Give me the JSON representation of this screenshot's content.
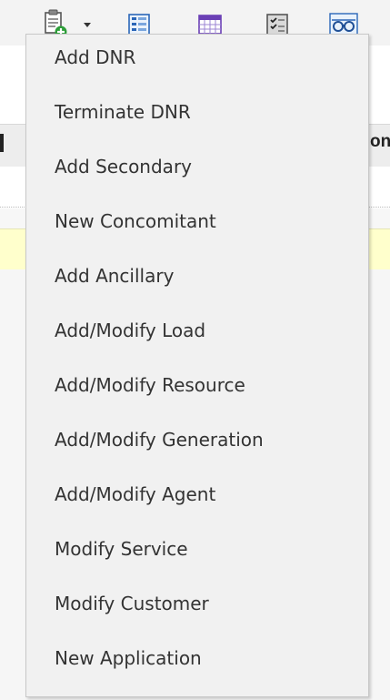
{
  "toolbar": {
    "icons": [
      "clipboard-add-icon",
      "chevron-down-icon",
      "list-view-icon",
      "grid-view-icon",
      "checklist-icon",
      "glasses-icon"
    ]
  },
  "menu": {
    "items": [
      {
        "label": "Add DNR"
      },
      {
        "label": "Terminate DNR"
      },
      {
        "label": "Add Secondary"
      },
      {
        "label": "New Concomitant"
      },
      {
        "label": "Add Ancillary"
      },
      {
        "label": "Add/Modify Load"
      },
      {
        "label": "Add/Modify Resource"
      },
      {
        "label": "Add/Modify Generation"
      },
      {
        "label": "Add/Modify Agent"
      },
      {
        "label": "Modify Service"
      },
      {
        "label": "Modify Customer"
      },
      {
        "label": "New Application"
      }
    ]
  },
  "background": {
    "header_clip_text": "on",
    "colors": {
      "menu_bg": "#f1f1f1",
      "menu_text": "#333333",
      "highlight_row": "#ffffcc",
      "icon_blue": "#1f5fb0",
      "icon_green": "#2e9e3a"
    }
  }
}
